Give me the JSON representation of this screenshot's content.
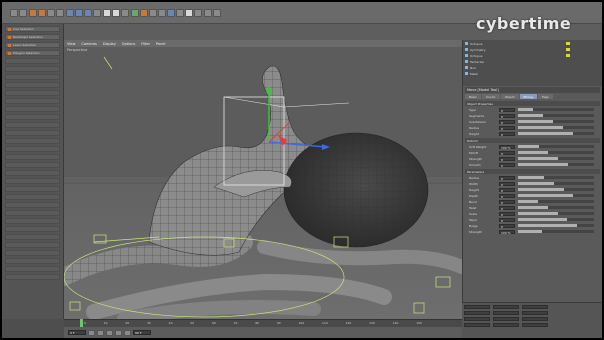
{
  "brand": {
    "logo_text": "cybertime"
  },
  "menu": [
    "View",
    "Cameras",
    "Display",
    "Options",
    "Filter",
    "Panel"
  ],
  "viewport": {
    "label": "Perspective"
  },
  "left_panel": {
    "items": [
      "Live Selection",
      "Rectangle Selection",
      "Lasso Selection",
      "Polygon Selection"
    ]
  },
  "object_manager": {
    "rows": [
      "Octopus",
      "Symmetry",
      "Octopus",
      "Tentacles",
      "Null",
      "Mesh"
    ]
  },
  "attributes": {
    "title": "Move [Model Tool]",
    "tabs": [
      "Basic",
      "Coord.",
      "Object",
      "Phong",
      "Tags"
    ],
    "sections": [
      {
        "name": "Object Properties",
        "rows": [
          {
            "label": "Type",
            "value": "0"
          },
          {
            "label": "Segments",
            "value": "0"
          },
          {
            "label": "Subdivision",
            "value": "0"
          },
          {
            "label": "Radius",
            "value": "0"
          },
          {
            "label": "Height",
            "value": "0"
          }
        ]
      },
      {
        "name": "Deform",
        "rows": [
          {
            "label": "Soft Weight",
            "value": "100 %"
          },
          {
            "label": "Falloff",
            "value": "0"
          },
          {
            "label": "Strength",
            "value": "0"
          },
          {
            "label": "Smooth",
            "value": "0"
          }
        ]
      },
      {
        "name": "Parameters",
        "rows": [
          {
            "label": "Radius",
            "value": "0"
          },
          {
            "label": "Width",
            "value": "0"
          },
          {
            "label": "Height",
            "value": "0"
          },
          {
            "label": "Depth",
            "value": "0"
          },
          {
            "label": "Bend",
            "value": "0"
          },
          {
            "label": "Twist",
            "value": "0"
          },
          {
            "label": "Scale",
            "value": "0"
          },
          {
            "label": "Taper",
            "value": "0"
          },
          {
            "label": "Bulge",
            "value": "0"
          },
          {
            "label": "Strength",
            "value": "100 %"
          }
        ]
      }
    ]
  },
  "timeline": {
    "ticks": [
      "0",
      "10",
      "20",
      "30",
      "40",
      "50",
      "60",
      "70",
      "80",
      "90",
      "100",
      "110",
      "120",
      "130",
      "140",
      "150"
    ],
    "start": "0 F",
    "end": "90 F"
  },
  "colors": {
    "wire": "#c8e87a",
    "axis_y": "#3ac83a",
    "axis_x": "#e83a3a",
    "axis_z": "#3a6ae8"
  }
}
